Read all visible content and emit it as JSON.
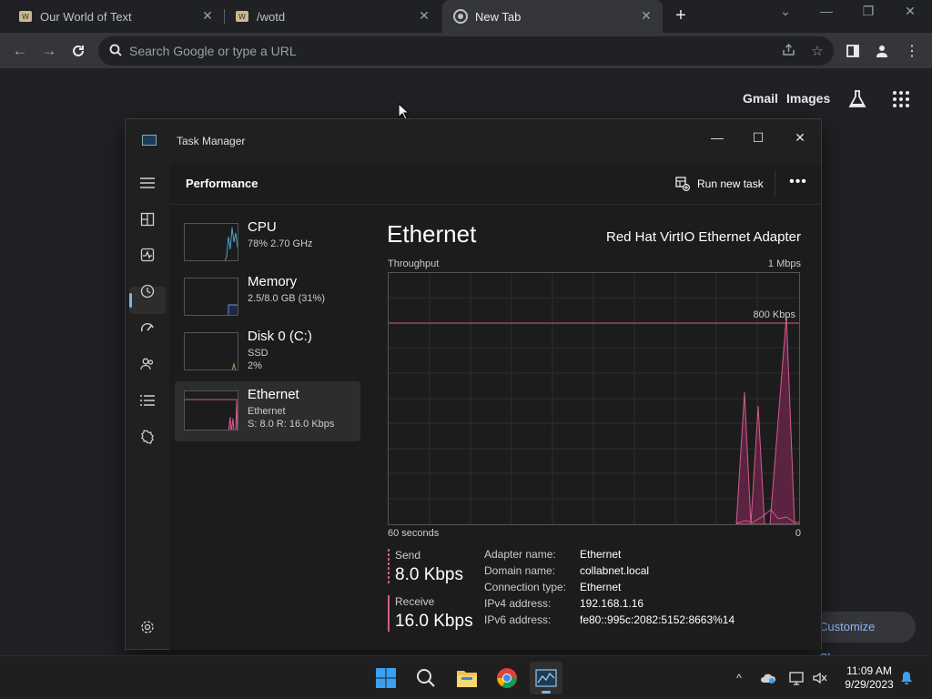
{
  "browser": {
    "tabs": [
      {
        "title": "Our World of Text",
        "icon": "owot-favicon"
      },
      {
        "title": "/wotd",
        "icon": "owot-favicon"
      },
      {
        "title": "New Tab",
        "icon": "chrome-favicon",
        "active": true
      }
    ],
    "omnibox_placeholder": "Search Google or type a URL",
    "ntp_links": {
      "gmail": "Gmail",
      "images": "Images"
    },
    "customize_label": "Customize Chrome"
  },
  "task_manager": {
    "window_title": "Task Manager",
    "page_title": "Performance",
    "run_new_task": "Run new task",
    "items": [
      {
        "name": "CPU",
        "sub1": "78%  2.70 GHz",
        "sub2": ""
      },
      {
        "name": "Memory",
        "sub1": "2.5/8.0 GB (31%)",
        "sub2": ""
      },
      {
        "name": "Disk 0 (C:)",
        "sub1": "SSD",
        "sub2": "2%"
      },
      {
        "name": "Ethernet",
        "sub1": "Ethernet",
        "sub2": "S: 8.0  R: 16.0 Kbps",
        "selected": true
      }
    ],
    "detail": {
      "title": "Ethernet",
      "adapter": "Red Hat VirtIO Ethernet Adapter",
      "throughput_label": "Throughput",
      "max_label": "1 Mbps",
      "line_label": "800 Kbps",
      "time_label": "60 seconds",
      "zero_label": "0",
      "send_label": "Send",
      "send_value": "8.0 Kbps",
      "receive_label": "Receive",
      "receive_value": "16.0 Kbps",
      "props": [
        {
          "k": "Adapter name:",
          "v": "Ethernet"
        },
        {
          "k": "Domain name:",
          "v": "collabnet.local"
        },
        {
          "k": "Connection type:",
          "v": "Ethernet"
        },
        {
          "k": "IPv4 address:",
          "v": "192.168.1.16"
        },
        {
          "k": "IPv6 address:",
          "v": "fe80::995c:2082:5152:8663%14"
        }
      ]
    },
    "colors": {
      "ethernet": "#d35c8c",
      "cpu": "#4aa3c9",
      "memory": "#6f8fd8",
      "disk": "#6cbf5a",
      "accent": "#76b9ed"
    }
  },
  "taskbar": {
    "time": "11:09 AM",
    "date": "9/29/2023"
  }
}
